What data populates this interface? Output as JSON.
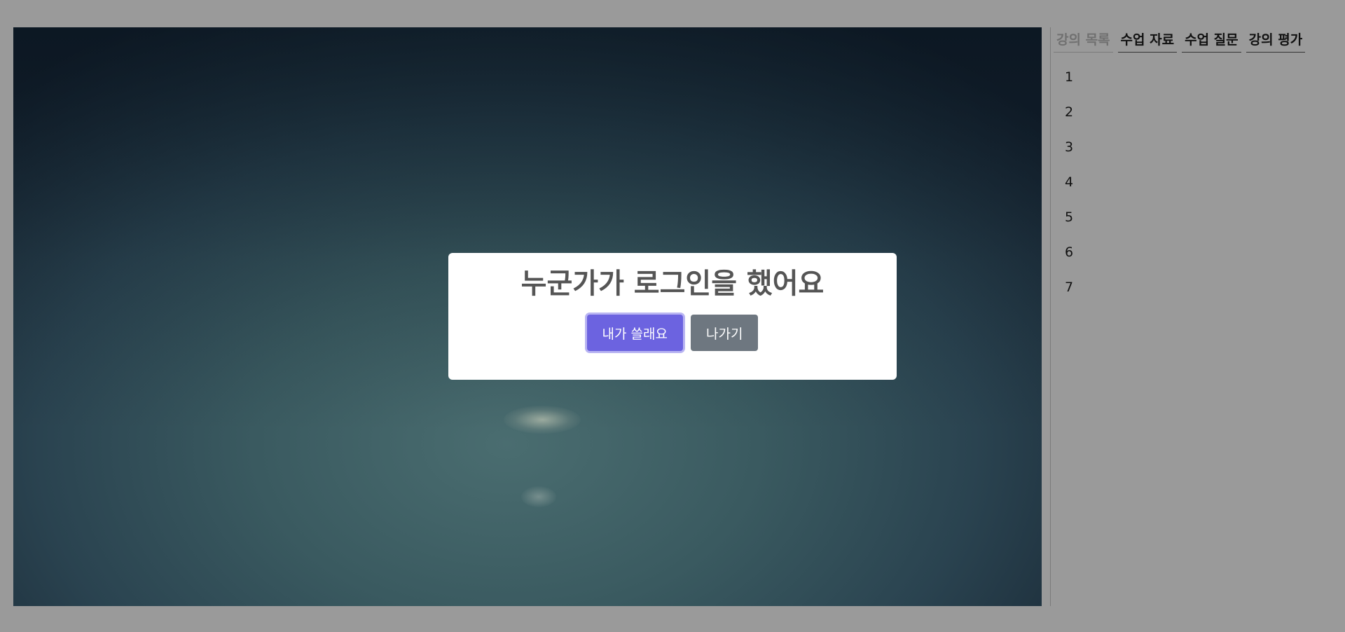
{
  "modal": {
    "title": "누군가가 로그인을 했어요",
    "primary_button": "내가 쓸래요",
    "secondary_button": "나가기"
  },
  "sidebar": {
    "tabs": [
      {
        "label": "강의 목록",
        "active": true
      },
      {
        "label": "수업 자료",
        "active": false
      },
      {
        "label": "수업 질문",
        "active": false
      },
      {
        "label": "강의 평가",
        "active": false
      }
    ],
    "lectures": [
      "1",
      "2",
      "3",
      "4",
      "5",
      "6",
      "7"
    ]
  },
  "colors": {
    "overlay_background": "#9a9a9a",
    "primary_button": "#6c63e0",
    "secondary_button": "#6e7780",
    "active_tab_text": "#707070"
  }
}
